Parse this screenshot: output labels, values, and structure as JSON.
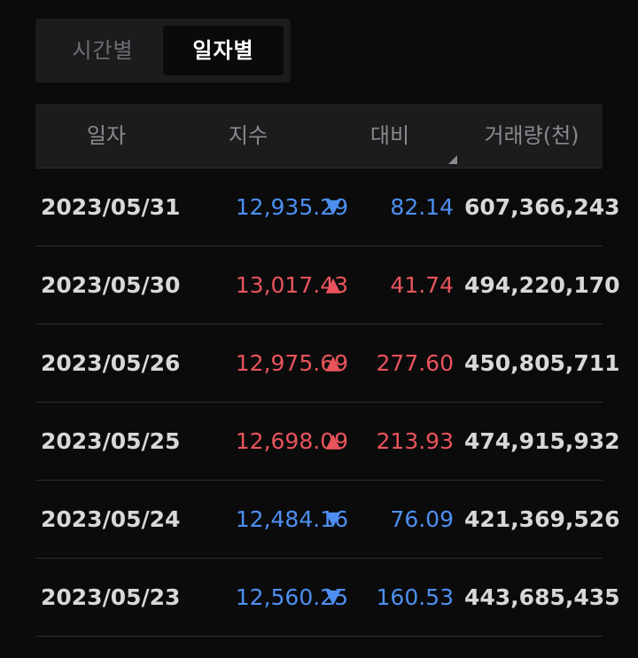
{
  "toggle": {
    "time_label": "시간별",
    "daily_label": "일자별",
    "selected": "daily"
  },
  "table": {
    "headers": {
      "date": "일자",
      "index": "지수",
      "change": "대비",
      "volume": "거래량(천)"
    },
    "rows": [
      {
        "date": "2023/05/31",
        "index": "12,935.29",
        "arrow": "▼",
        "direction": "down",
        "change": "82.14",
        "volume": "607,366,243"
      },
      {
        "date": "2023/05/30",
        "index": "13,017.43",
        "arrow": "▲",
        "direction": "up",
        "change": "41.74",
        "volume": "494,220,170"
      },
      {
        "date": "2023/05/26",
        "index": "12,975.69",
        "arrow": "▲",
        "direction": "up",
        "change": "277.60",
        "volume": "450,805,711"
      },
      {
        "date": "2023/05/25",
        "index": "12,698.09",
        "arrow": "▲",
        "direction": "up",
        "change": "213.93",
        "volume": "474,915,932"
      },
      {
        "date": "2023/05/24",
        "index": "12,484.16",
        "arrow": "▼",
        "direction": "down",
        "change": "76.09",
        "volume": "421,369,526"
      },
      {
        "date": "2023/05/23",
        "index": "12,560.25",
        "arrow": "▼",
        "direction": "down",
        "change": "160.53",
        "volume": "443,685,435"
      }
    ]
  },
  "colors": {
    "up": "#e9545c",
    "down": "#4d8ff0",
    "background": "#0b0b0c",
    "header_bg": "#1c1c1e"
  },
  "icons": {
    "sort": "sort-corner-icon",
    "up": "triangle-up-icon",
    "down": "triangle-down-icon"
  }
}
